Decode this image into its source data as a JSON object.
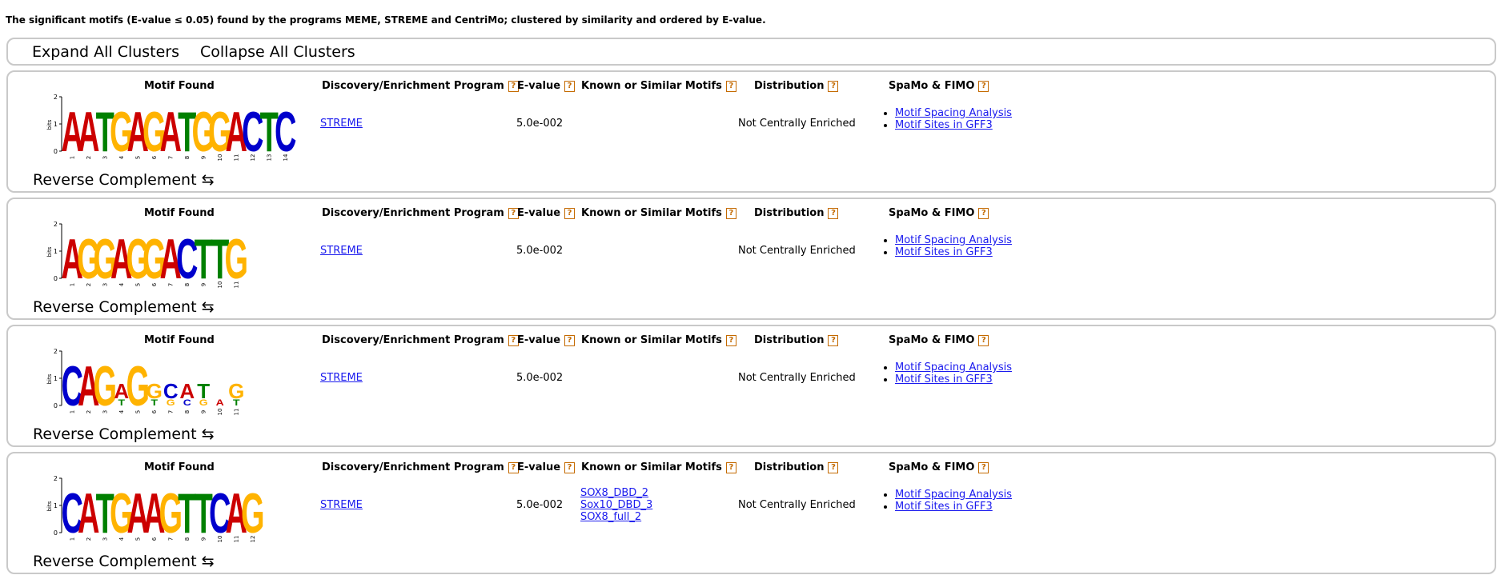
{
  "summary": "The significant motifs (E-value ≤ 0.05) found by the programs MEME, STREME and CentriMo; clustered by similarity and ordered by E-value.",
  "controls": {
    "expand_label": "Expand All Clusters",
    "collapse_label": "Collapse All Clusters"
  },
  "headers": {
    "motif_found": "Motif Found",
    "program": "Discovery/Enrichment Program",
    "evalue": "E-value",
    "known": "Known or Similar Motifs",
    "distribution": "Distribution",
    "spamo": "SpaMo & FIMO",
    "help_glyph": "?"
  },
  "reverse_label": "Reverse Complement ⇆",
  "logo_axis": {
    "ylabel": "bits",
    "ticks": [
      "0",
      "1",
      "2"
    ]
  },
  "base_colors": {
    "A": "#cc0000",
    "C": "#0000cc",
    "G": "#ffb300",
    "T": "#008000"
  },
  "link_color": "#1a1aee",
  "help_color": "#c46a00",
  "motifs": [
    {
      "logo": [
        [
          "A"
        ],
        [
          "A"
        ],
        [
          "T"
        ],
        [
          "G"
        ],
        [
          "A"
        ],
        [
          "G"
        ],
        [
          "A"
        ],
        [
          "T"
        ],
        [
          "G"
        ],
        [
          "G"
        ],
        [
          "A"
        ],
        [
          "C"
        ],
        [
          "T"
        ],
        [
          "C"
        ]
      ],
      "positions": [
        "1",
        "2",
        "3",
        "4",
        "5",
        "6",
        "7",
        "8",
        "9",
        "10",
        "11",
        "12",
        "13",
        "14"
      ],
      "program": "STREME",
      "evalue": "5.0e-002",
      "known": [],
      "distribution": "Not Centrally Enriched",
      "spamo_links": [
        "Motif Spacing Analysis",
        "Motif Sites in GFF3"
      ]
    },
    {
      "logo": [
        [
          "A"
        ],
        [
          "G"
        ],
        [
          "G"
        ],
        [
          "A"
        ],
        [
          "G"
        ],
        [
          "G"
        ],
        [
          "A"
        ],
        [
          "C"
        ],
        [
          "T"
        ],
        [
          "T"
        ],
        [
          "G"
        ]
      ],
      "positions": [
        "1",
        "2",
        "3",
        "4",
        "5",
        "6",
        "7",
        "8",
        "9",
        "10",
        "11"
      ],
      "program": "STREME",
      "evalue": "5.0e-002",
      "known": [],
      "distribution": "Not Centrally Enriched",
      "spamo_links": [
        "Motif Spacing Analysis",
        "Motif Sites in GFF3"
      ]
    },
    {
      "logo": [
        [
          "C"
        ],
        [
          "A"
        ],
        [
          "G"
        ],
        [
          "A",
          "T"
        ],
        [
          "G"
        ],
        [
          "G",
          "T"
        ],
        [
          "C",
          "G"
        ],
        [
          "A",
          "C"
        ],
        [
          "T",
          "G"
        ],
        [
          "",
          "A"
        ],
        [
          "G",
          "T"
        ]
      ],
      "positions": [
        "1",
        "2",
        "3",
        "4",
        "5",
        "6",
        "7",
        "8",
        "9",
        "10",
        "11"
      ],
      "program": "STREME",
      "evalue": "5.0e-002",
      "known": [],
      "distribution": "Not Centrally Enriched",
      "spamo_links": [
        "Motif Spacing Analysis",
        "Motif Sites in GFF3"
      ]
    },
    {
      "logo": [
        [
          "C"
        ],
        [
          "A"
        ],
        [
          "T"
        ],
        [
          "G"
        ],
        [
          "A"
        ],
        [
          "A"
        ],
        [
          "G"
        ],
        [
          "T"
        ],
        [
          "T"
        ],
        [
          "C"
        ],
        [
          "A"
        ],
        [
          "G"
        ]
      ],
      "positions": [
        "1",
        "2",
        "3",
        "4",
        "5",
        "6",
        "7",
        "8",
        "9",
        "10",
        "11",
        "12"
      ],
      "program": "STREME",
      "evalue": "5.0e-002",
      "known": [
        "SOX8_DBD_2",
        "Sox10_DBD_3",
        "SOX8_full_2"
      ],
      "distribution": "Not Centrally Enriched",
      "spamo_links": [
        "Motif Spacing Analysis",
        "Motif Sites in GFF3"
      ]
    }
  ]
}
